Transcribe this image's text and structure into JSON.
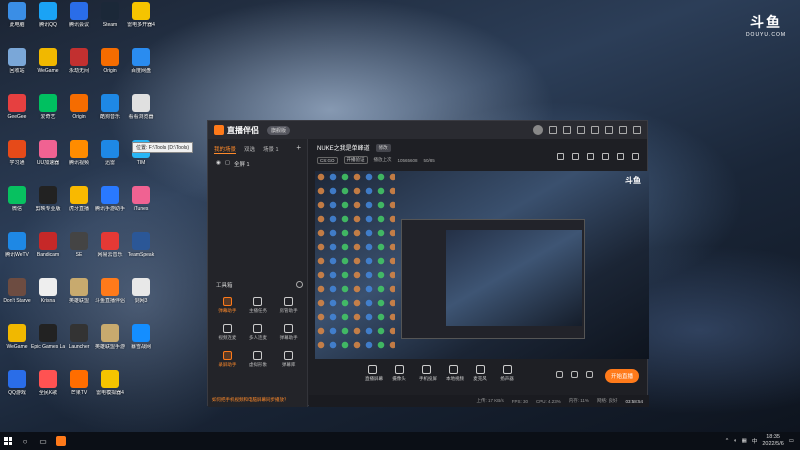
{
  "desktop": {
    "icons": [
      {
        "label": "此电脑",
        "color": "#3a8ee6"
      },
      {
        "label": "腾讯QQ",
        "color": "#1aa3f5"
      },
      {
        "label": "腾讯会议",
        "color": "#2a6de8"
      },
      {
        "label": "Steam",
        "color": "#1b2838"
      },
      {
        "label": "雷电多开器4",
        "color": "#f5c400"
      },
      {
        "label": "回收站",
        "color": "#7aa7d8"
      },
      {
        "label": "WeGame",
        "color": "#f1b800"
      },
      {
        "label": "永劫无间",
        "color": "#c23030"
      },
      {
        "label": "Origin",
        "color": "#f56c00"
      },
      {
        "label": "百度网盘",
        "color": "#2a8cf0"
      },
      {
        "label": "GeeGee",
        "color": "#e64040"
      },
      {
        "label": "爱奇艺",
        "color": "#00c060"
      },
      {
        "label": "Origin",
        "color": "#f56c00"
      },
      {
        "label": "酷狗音乐",
        "color": "#1e88e5"
      },
      {
        "label": "看看浏览器",
        "color": "#e0e0e0"
      },
      {
        "label": "学习通",
        "color": "#e64a19"
      },
      {
        "label": "UU加速器",
        "color": "#f06292"
      },
      {
        "label": "腾讯视频",
        "color": "#ff8c00"
      },
      {
        "label": "迅雷",
        "color": "#1e88e5"
      },
      {
        "label": "TIM",
        "color": "#29b6f6"
      },
      {
        "label": "微信",
        "color": "#07c160"
      },
      {
        "label": "剪映专业版",
        "color": "#222"
      },
      {
        "label": "虎牙直播",
        "color": "#f9b900"
      },
      {
        "label": "腾讯手游助手",
        "color": "#2979ff"
      },
      {
        "label": "iTunes",
        "color": "#f06292"
      },
      {
        "label": "腾讯WeTV",
        "color": "#1e88e5"
      },
      {
        "label": "Bandicam",
        "color": "#c62828"
      },
      {
        "label": "SE",
        "color": "#444"
      },
      {
        "label": "网易云音乐",
        "color": "#e53935"
      },
      {
        "label": "TeamSpeak",
        "color": "#2b5797"
      },
      {
        "label": "Don't Starve",
        "color": "#6d4c41"
      },
      {
        "label": "Krisna",
        "color": "#eee"
      },
      {
        "label": "英雄联盟",
        "color": "#c8aa6e"
      },
      {
        "label": "斗鱼直播伴侣",
        "color": "#ff7a1a"
      },
      {
        "label": "剑网3",
        "color": "#e8e8e8"
      },
      {
        "label": "WeGame",
        "color": "#f1b800"
      },
      {
        "label": "Epic Games Launcher",
        "color": "#222"
      },
      {
        "label": "Launcher",
        "color": "#333"
      },
      {
        "label": "英雄联盟手游",
        "color": "#c8aa6e"
      },
      {
        "label": "暴雪战网",
        "color": "#148eff"
      },
      {
        "label": "QQ游戏",
        "color": "#2a6de8"
      },
      {
        "label": "全民K歌",
        "color": "#ff5252"
      },
      {
        "label": "芒果TV",
        "color": "#ff6d00"
      },
      {
        "label": "雷电模拟器4",
        "color": "#f5c400"
      }
    ],
    "tooltip": "位置: F:\\Tools (D:\\Tools)",
    "brand_logo": {
      "big": "斗鱼",
      "small": "DOUYU.COM"
    }
  },
  "app": {
    "name": "直播伴侣",
    "version_pill": "旗舰版",
    "scene_tabs": [
      "我的场景",
      "双选",
      "场景 1"
    ],
    "source_row": "全屏 1",
    "tools_title": "工具箱",
    "tools": [
      {
        "label": "弹幕助手",
        "highlight": true
      },
      {
        "label": "主播任务",
        "highlight": false
      },
      {
        "label": "房管助手",
        "highlight": false
      },
      {
        "label": "视频连麦",
        "highlight": false
      },
      {
        "label": "多人连麦",
        "highlight": false
      },
      {
        "label": "弹幕助手",
        "highlight": false
      },
      {
        "label": "录屏助手",
        "highlight": true
      },
      {
        "label": "虚拟形象",
        "highlight": false
      },
      {
        "label": "弹幕库",
        "highlight": false
      }
    ],
    "left_footer": "如何把手机视频和电脑屏幕同步播放？",
    "room": {
      "title": "NUKE之我是单峰道",
      "edit_label": "修改",
      "tags": [
        "CS:GO",
        "开播验证"
      ],
      "meta": [
        "播放上次",
        "10565608",
        "50/85"
      ]
    },
    "bottom_tools": [
      "直播屏幕",
      "摄像头",
      "手机投屏",
      "本地视频",
      "麦克风",
      "扬声器"
    ],
    "start_button": "开始直播",
    "status": {
      "upload": "上传: 17 KB/s",
      "fps": "FPS: 30",
      "cpu": "CPU: 4.23%",
      "memory": "内存: 11%",
      "net": "网络: 良好",
      "time": "03:58:54"
    },
    "preview_logo": "斗鱼"
  },
  "taskbar": {
    "time": "18:35",
    "date": "2022/5/6",
    "lang": "中"
  }
}
